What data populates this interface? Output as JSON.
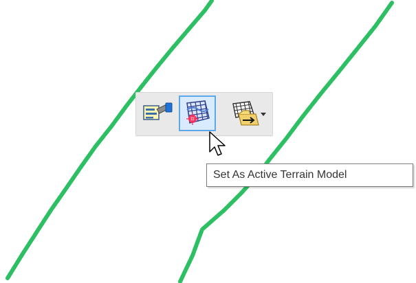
{
  "canvas": {
    "line_color": "#2dbf63"
  },
  "toolbar": {
    "buttons": [
      {
        "icon": "properties-icon"
      },
      {
        "icon": "terrain-active-icon"
      },
      {
        "icon": "terrain-apply-icon"
      }
    ]
  },
  "tooltip": {
    "text": "Set As Active Terrain Model"
  }
}
